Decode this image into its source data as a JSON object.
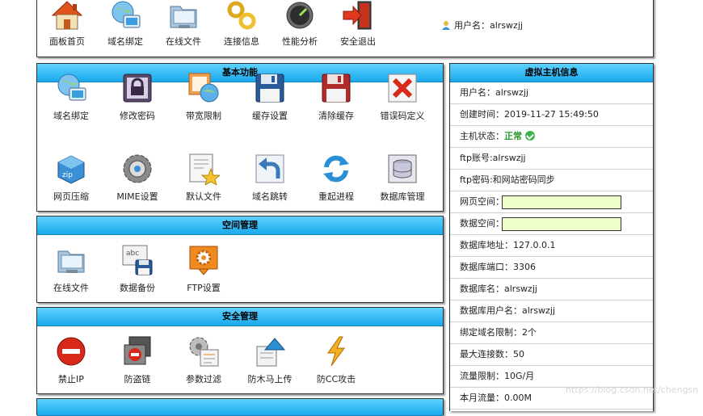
{
  "header": {
    "nav": [
      {
        "label": "面板首页",
        "icon": "home-icon"
      },
      {
        "label": "域名绑定",
        "icon": "globe-monitor-icon"
      },
      {
        "label": "在线文件",
        "icon": "folder-icon"
      },
      {
        "label": "连接信息",
        "icon": "link-icon"
      },
      {
        "label": "性能分析",
        "icon": "gauge-icon"
      },
      {
        "label": "安全退出",
        "icon": "logout-icon"
      }
    ],
    "user_label": "用户名：alrswzjj"
  },
  "basic": {
    "title": "基本功能",
    "items": [
      {
        "label": "域名绑定",
        "icon": "globe-monitor-icon"
      },
      {
        "label": "修改密码",
        "icon": "lock-icon"
      },
      {
        "label": "带宽限制",
        "icon": "bandwidth-icon"
      },
      {
        "label": "缓存设置",
        "icon": "floppy-icon"
      },
      {
        "label": "清除缓存",
        "icon": "floppy-red-icon"
      },
      {
        "label": "错误码定义",
        "icon": "error-x-icon"
      },
      {
        "label": "网页压缩",
        "icon": "zip-icon"
      },
      {
        "label": "MIME设置",
        "icon": "mime-gear-icon"
      },
      {
        "label": "默认文件",
        "icon": "star-document-icon"
      },
      {
        "label": "域名跳转",
        "icon": "redirect-arrow-icon"
      },
      {
        "label": "重起进程",
        "icon": "refresh-icon"
      },
      {
        "label": "数据库管理",
        "icon": "database-icon"
      }
    ]
  },
  "space": {
    "title": "空间管理",
    "items": [
      {
        "label": "在线文件",
        "icon": "folder-icon"
      },
      {
        "label": "数据备份",
        "icon": "backup-icon"
      },
      {
        "label": "FTP设置",
        "icon": "ftp-gear-icon"
      }
    ]
  },
  "security": {
    "title": "安全管理",
    "items": [
      {
        "label": "禁止IP",
        "icon": "forbidden-icon"
      },
      {
        "label": "防盗链",
        "icon": "hotlink-icon"
      },
      {
        "label": "参数过滤",
        "icon": "filter-gear-icon"
      },
      {
        "label": "防木马上传",
        "icon": "upload-shield-icon"
      },
      {
        "label": "防CC攻击",
        "icon": "lightning-icon"
      }
    ]
  },
  "info": {
    "title": "虚拟主机信息",
    "rows": [
      "用户名：alrswzjj",
      "创建时间：2019-11-27 15:49:50",
      "主机状态：",
      "ftp账号:alrswzjj",
      "ftp密码:和网站密码同步",
      "网页空间：",
      "数据空间：",
      "数据库地址：127.0.0.1",
      "数据库端口：3306",
      "数据库名：alrswzjj",
      "数据库用户名：alrswzjj",
      "绑定域名限制：2个",
      "最大连接数：50",
      "流量限制：10G/月",
      "本月流量：0.00M"
    ],
    "status_value": "正常",
    "web_space_used": 0,
    "data_space_used": 0
  },
  "watermark": "https://blog.csdn.net/chengsn"
}
